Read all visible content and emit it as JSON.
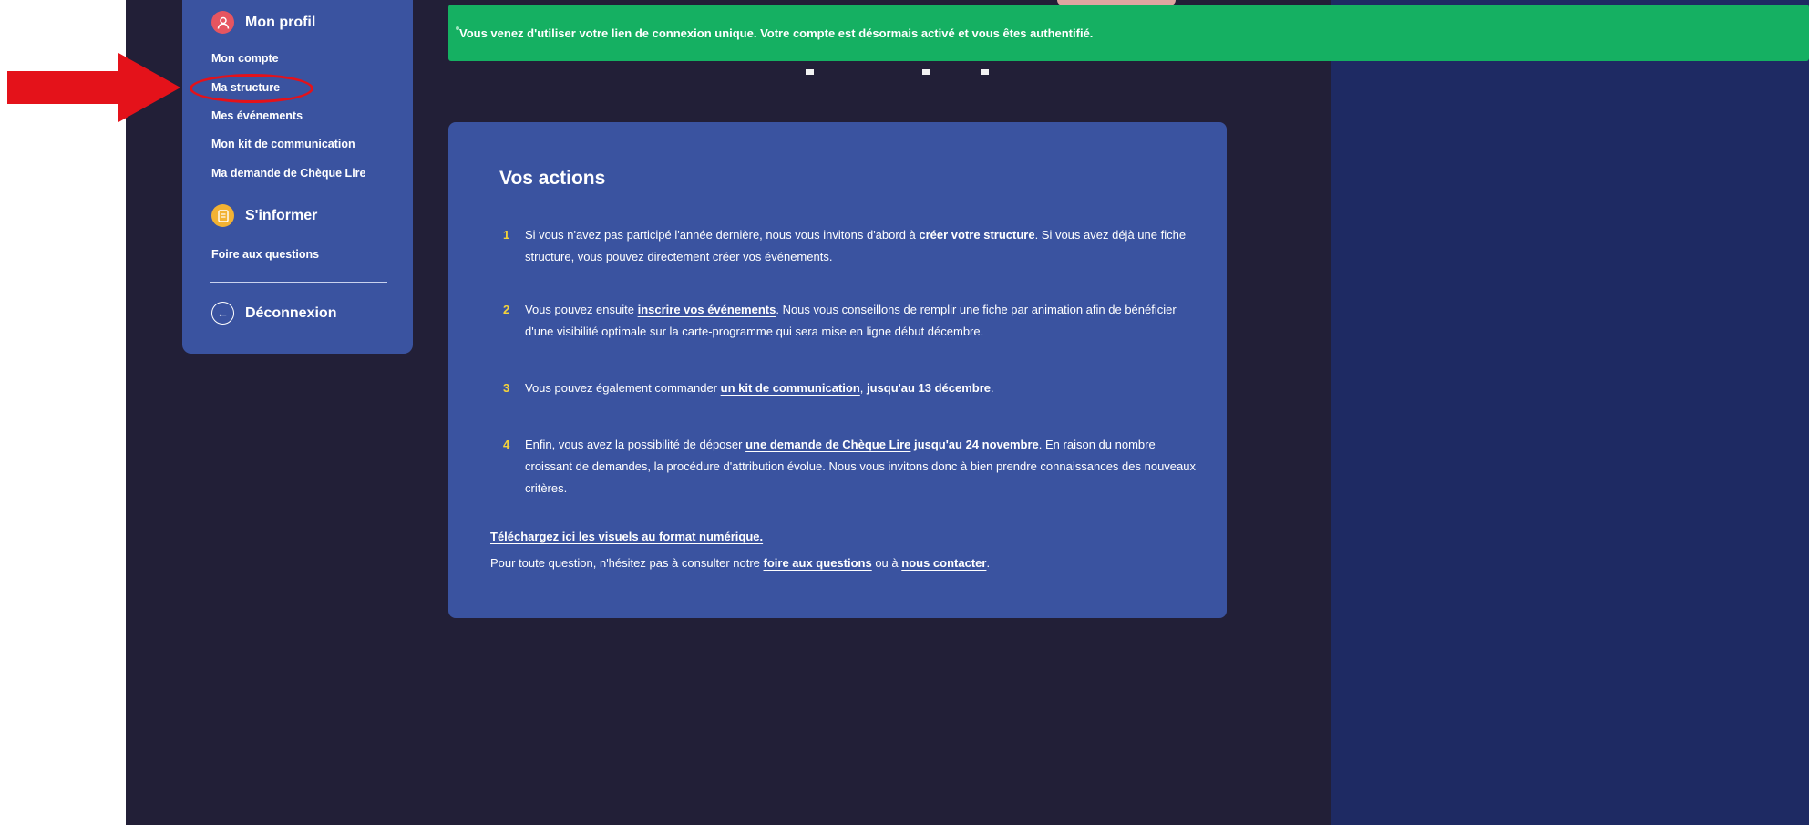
{
  "toast": {
    "message": "Vous venez d'utiliser votre lien de connexion unique. Votre compte est désormais activé et vous êtes authentifié."
  },
  "sidebar": {
    "profile": {
      "title": "Mon profil",
      "icon": "user-icon",
      "items": [
        "Mon compte",
        "Ma structure",
        "Mes événements",
        "Mon kit de communication",
        "Ma demande de Chèque Lire"
      ]
    },
    "info": {
      "title": "S'informer",
      "icon": "document-icon",
      "items": [
        "Foire aux questions"
      ]
    },
    "logout": {
      "label": "Déconnexion",
      "icon": "logout-icon"
    }
  },
  "actions": {
    "title": "Vos actions",
    "steps": [
      {
        "num": "1",
        "a": "Si vous n'avez pas participé l'année dernière, nous vous invitons d'abord à ",
        "link": "créer votre structure",
        "b": ". Si vous avez déjà une fiche structure, vous pouvez directement créer vos événements."
      },
      {
        "num": "2",
        "a": "Vous pouvez ensuite ",
        "link": "inscrire vos événements",
        "b": ". Nous vous conseillons de remplir une fiche par animation afin de bénéficier d'une visibilité optimale sur la carte-programme qui sera mise en ligne début décembre."
      },
      {
        "num": "3",
        "a": "Vous pouvez également commander ",
        "link": "un kit de communication",
        "b": ", ",
        "bold": "jusqu'au 13 décembre",
        "c": "."
      },
      {
        "num": "4",
        "a": "Enfin, vous avez la possibilité de déposer ",
        "link": "une demande de Chèque Lire",
        "bold": " jusqu'au 24 novembre",
        "b": ". En raison du nombre croissant de demandes, la procédure d'attribution évolue. Nous vous invitons donc à bien prendre connaissances des nouveaux critères."
      }
    ],
    "download_link": "Téléchargez ici les visuels au format numérique.",
    "contact": {
      "a": "Pour toute question, n'hésitez pas à consulter notre ",
      "link1": "foire aux questions",
      "b": " ou à ",
      "link2": "nous contacter",
      "c": "."
    }
  },
  "colors": {
    "page_bg": "#221f37",
    "panel_blue": "#3a53a0",
    "toast_green": "#15b062",
    "accent_yellow": "#f5d33a",
    "annotation_red": "#e4121a"
  }
}
